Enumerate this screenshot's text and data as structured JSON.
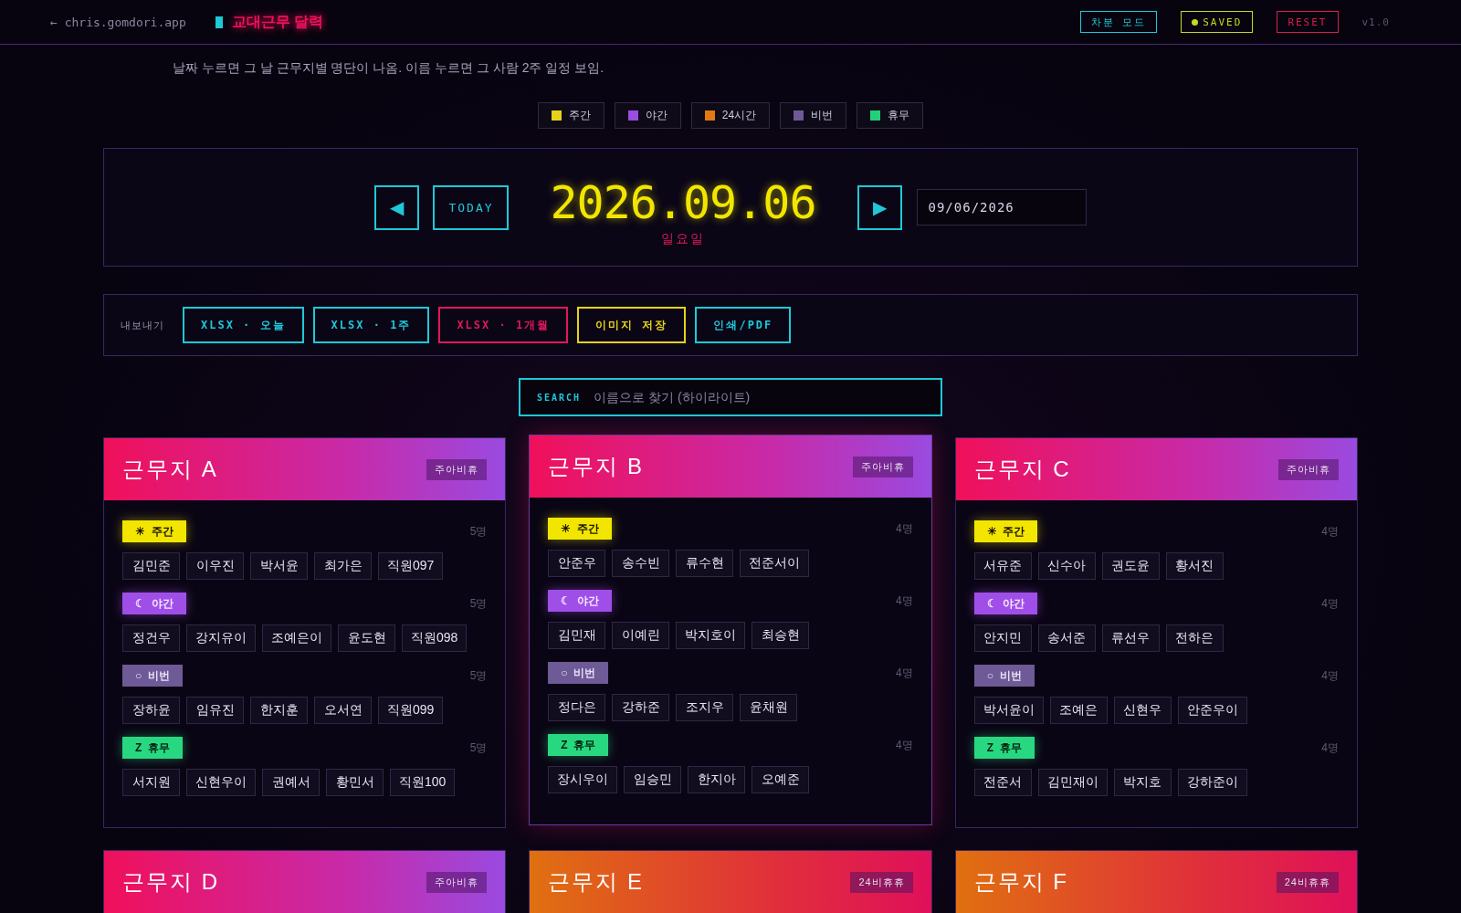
{
  "topbar": {
    "back_link": "← chris.gomdori.app",
    "logo": "교대근무 달력",
    "buttons": [
      {
        "label": "차분 모드",
        "color": "#1fc8d8",
        "dot": false
      },
      {
        "label": "SAVED",
        "color": "#c8d81f",
        "dot": true
      },
      {
        "label": "RESET",
        "color": "#d81f4a",
        "dot": false
      }
    ],
    "version": "v1.0"
  },
  "subtitle": "날짜 누르면 그 날 근무지별 명단이 나옴. 이름 누르면 그 사람 2주 일정 보임.",
  "legend": [
    {
      "label": "주간",
      "color": "#e5d21a"
    },
    {
      "label": "야간",
      "color": "#9a4de0"
    },
    {
      "label": "24시간",
      "color": "#e07a10"
    },
    {
      "label": "비번",
      "color": "#6e5a96"
    },
    {
      "label": "휴무",
      "color": "#22d07a"
    }
  ],
  "date_nav": {
    "prev": "◀",
    "today": "TODAY",
    "date": "2026.09.06",
    "weekday": "일요일",
    "next": "▶",
    "date_input": "09/06/2026"
  },
  "export": {
    "label": "내보내기",
    "buttons": [
      {
        "label": "XLSX · 오늘",
        "color": "#1fc8d8"
      },
      {
        "label": "XLSX · 1주",
        "color": "#1fc8d8"
      },
      {
        "label": "XLSX · 1개월",
        "color": "#e0185a"
      },
      {
        "label": "이미지 저장",
        "color": "#e5d21a"
      },
      {
        "label": "인쇄/PDF",
        "color": "#1fc8d8"
      }
    ]
  },
  "search": {
    "label": "SEARCH",
    "placeholder": "이름으로 찾기 (하이라이트)"
  },
  "sites": [
    {
      "name": "근무지 A",
      "tag": "주아비휴",
      "kind": "day",
      "highlighted": false,
      "groups": [
        {
          "kind": "day",
          "icon": "☀",
          "label": "주간",
          "count": "5명",
          "people": [
            "김민준",
            "이우진",
            "박서윤",
            "최가은",
            "직원097"
          ]
        },
        {
          "kind": "night",
          "icon": "☾",
          "label": "야간",
          "count": "5명",
          "people": [
            "정건우",
            "강지유이",
            "조예은이",
            "윤도현",
            "직원098"
          ]
        },
        {
          "kind": "off",
          "icon": "○",
          "label": "비번",
          "count": "5명",
          "people": [
            "장하윤",
            "임유진",
            "한지훈",
            "오서연",
            "직원099"
          ]
        },
        {
          "kind": "rest",
          "icon": "Z",
          "label": "휴무",
          "count": "5명",
          "people": [
            "서지원",
            "신현우이",
            "권예서",
            "황민서",
            "직원100"
          ]
        }
      ]
    },
    {
      "name": "근무지 B",
      "tag": "주아비휴",
      "kind": "day",
      "highlighted": true,
      "groups": [
        {
          "kind": "day",
          "icon": "☀",
          "label": "주간",
          "count": "4명",
          "people": [
            "안준우",
            "송수빈",
            "류수현",
            "전준서이"
          ]
        },
        {
          "kind": "night",
          "icon": "☾",
          "label": "야간",
          "count": "4명",
          "people": [
            "김민재",
            "이예린",
            "박지호이",
            "최승현"
          ]
        },
        {
          "kind": "off",
          "icon": "○",
          "label": "비번",
          "count": "4명",
          "people": [
            "정다은",
            "강하준",
            "조지우",
            "윤채원"
          ]
        },
        {
          "kind": "rest",
          "icon": "Z",
          "label": "휴무",
          "count": "4명",
          "people": [
            "장시우이",
            "임승민",
            "한지아",
            "오예준"
          ]
        }
      ]
    },
    {
      "name": "근무지 C",
      "tag": "주아비휴",
      "kind": "day",
      "highlighted": false,
      "groups": [
        {
          "kind": "day",
          "icon": "☀",
          "label": "주간",
          "count": "4명",
          "people": [
            "서유준",
            "신수아",
            "권도윤",
            "황서진"
          ]
        },
        {
          "kind": "night",
          "icon": "☾",
          "label": "야간",
          "count": "4명",
          "people": [
            "안지민",
            "송서준",
            "류선우",
            "전하은"
          ]
        },
        {
          "kind": "off",
          "icon": "○",
          "label": "비번",
          "count": "4명",
          "people": [
            "박서윤이",
            "조예은",
            "신현우",
            "안준우이"
          ]
        },
        {
          "kind": "rest",
          "icon": "Z",
          "label": "휴무",
          "count": "4명",
          "people": [
            "전준서",
            "김민재이",
            "박지호",
            "강하준이"
          ]
        }
      ]
    },
    {
      "name": "근무지 D",
      "tag": "주아비휴",
      "kind": "day",
      "highlighted": false
    },
    {
      "name": "근무지 E",
      "tag": "24비휴휴",
      "kind": "fullday",
      "highlighted": false
    },
    {
      "name": "근무지 F",
      "tag": "24비휴휴",
      "kind": "fullday",
      "highlighted": false
    }
  ]
}
